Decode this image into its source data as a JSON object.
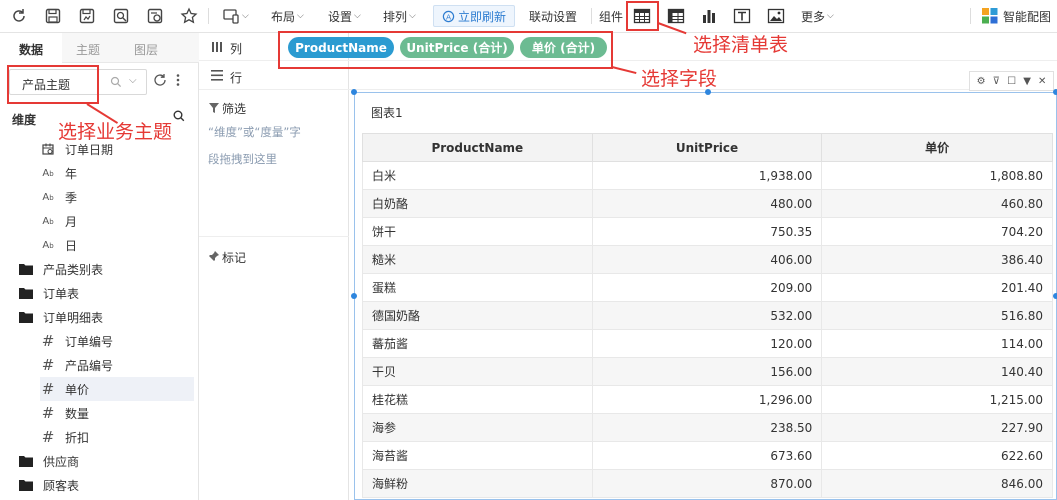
{
  "toolbar": {
    "layout": "布局",
    "settings": "设置",
    "arrange": "排列",
    "refresh": "立即刷新",
    "link": "联动设置",
    "components": "组件",
    "more": "更多",
    "smart": "智能配图"
  },
  "left": {
    "tabs": [
      "数据",
      "主题",
      "图层"
    ],
    "topic": "产品主题",
    "dimension_label": "维度",
    "tree": [
      {
        "label": "订单日期",
        "icon": "calendar-icon"
      },
      {
        "label": "年",
        "icon": "text-field-icon"
      },
      {
        "label": "季",
        "icon": "text-field-icon"
      },
      {
        "label": "月",
        "icon": "text-field-icon"
      },
      {
        "label": "日",
        "icon": "text-field-icon"
      },
      {
        "label": "产品类别表",
        "icon": "folder-icon"
      },
      {
        "label": "订单表",
        "icon": "folder-icon"
      },
      {
        "label": "订单明细表",
        "icon": "folder-icon"
      },
      {
        "label": "订单编号",
        "icon": "hash-icon"
      },
      {
        "label": "产品编号",
        "icon": "hash-icon"
      },
      {
        "label": "单价",
        "icon": "hash-icon"
      },
      {
        "label": "数量",
        "icon": "hash-icon"
      },
      {
        "label": "折扣",
        "icon": "hash-icon"
      },
      {
        "label": "供应商",
        "icon": "folder-icon"
      },
      {
        "label": "顾客表",
        "icon": "folder-icon"
      }
    ]
  },
  "shelves": {
    "columns": "列",
    "rows": "行",
    "pills": [
      "ProductName",
      "UnitPrice (合计)",
      "单价 (合计)"
    ]
  },
  "filter": {
    "title": "筛选",
    "hint_line1": "“维度”或“度量”字",
    "hint_line2": "段拖拽到这里",
    "marks": "标记"
  },
  "annotations": {
    "topic": "选择业务主题",
    "table": "选择清单表",
    "fields": "选择字段"
  },
  "chart": {
    "title": "图表1",
    "headers": [
      "ProductName",
      "UnitPrice",
      "单价"
    ],
    "rows": [
      [
        "白米",
        "1,938.00",
        "1,808.80"
      ],
      [
        "白奶酪",
        "480.00",
        "460.80"
      ],
      [
        "饼干",
        "750.35",
        "704.20"
      ],
      [
        "糙米",
        "406.00",
        "386.40"
      ],
      [
        "蛋糕",
        "209.00",
        "201.40"
      ],
      [
        "德国奶酪",
        "532.00",
        "516.80"
      ],
      [
        "蕃茄酱",
        "120.00",
        "114.00"
      ],
      [
        "干贝",
        "156.00",
        "140.40"
      ],
      [
        "桂花糕",
        "1,296.00",
        "1,215.00"
      ],
      [
        "海参",
        "238.50",
        "227.90"
      ],
      [
        "海苔酱",
        "673.60",
        "622.60"
      ],
      [
        "海鲜粉",
        "870.00",
        "846.00"
      ]
    ]
  },
  "colors": {
    "pill_dimension": "#2b9bd1",
    "pill_measure": "#6cbb92",
    "annotation": "#e53935",
    "selection": "#2e86de"
  }
}
